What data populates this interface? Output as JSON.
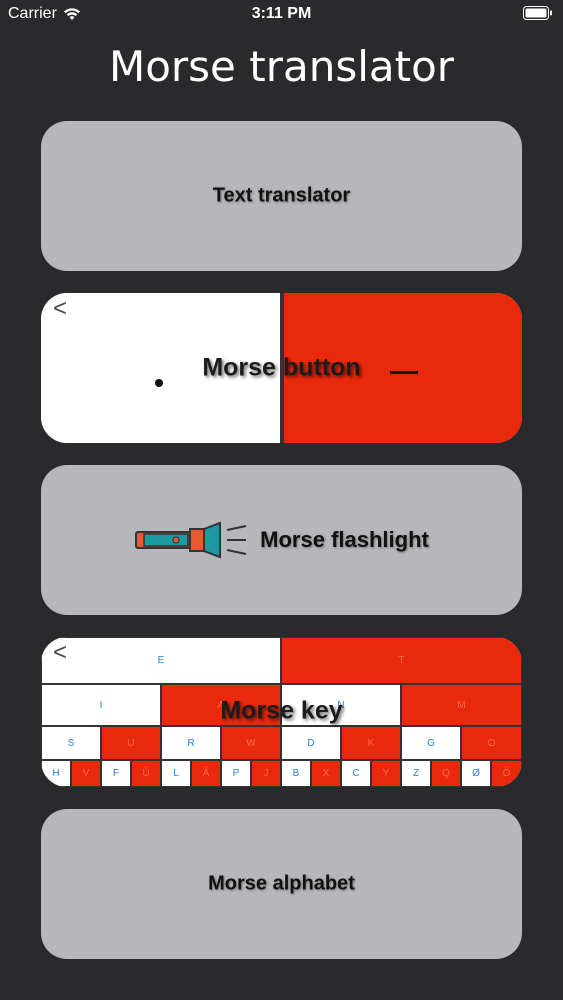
{
  "status": {
    "carrier": "Carrier",
    "time": "3:11 PM"
  },
  "title": "Morse translator",
  "cards": {
    "text_translator": "Text translator",
    "morse_button": "Morse button",
    "morse_flashlight": "Morse flashlight",
    "morse_key": "Morse key",
    "morse_alphabet": "Morse alphabet"
  },
  "morse_key_preview": {
    "row1": [
      "E",
      "T"
    ],
    "row2": [
      "I",
      "A",
      "N",
      "M"
    ],
    "row3": [
      "S",
      "U",
      "R",
      "W",
      "D",
      "K",
      "G",
      "O"
    ],
    "row4": [
      "H",
      "V",
      "F",
      "Ü",
      "L",
      "Ä",
      "P",
      "J",
      "B",
      "X",
      "C",
      "Y",
      "Z",
      "Q",
      "Ø",
      "Ö"
    ]
  },
  "back_glyph": "<"
}
